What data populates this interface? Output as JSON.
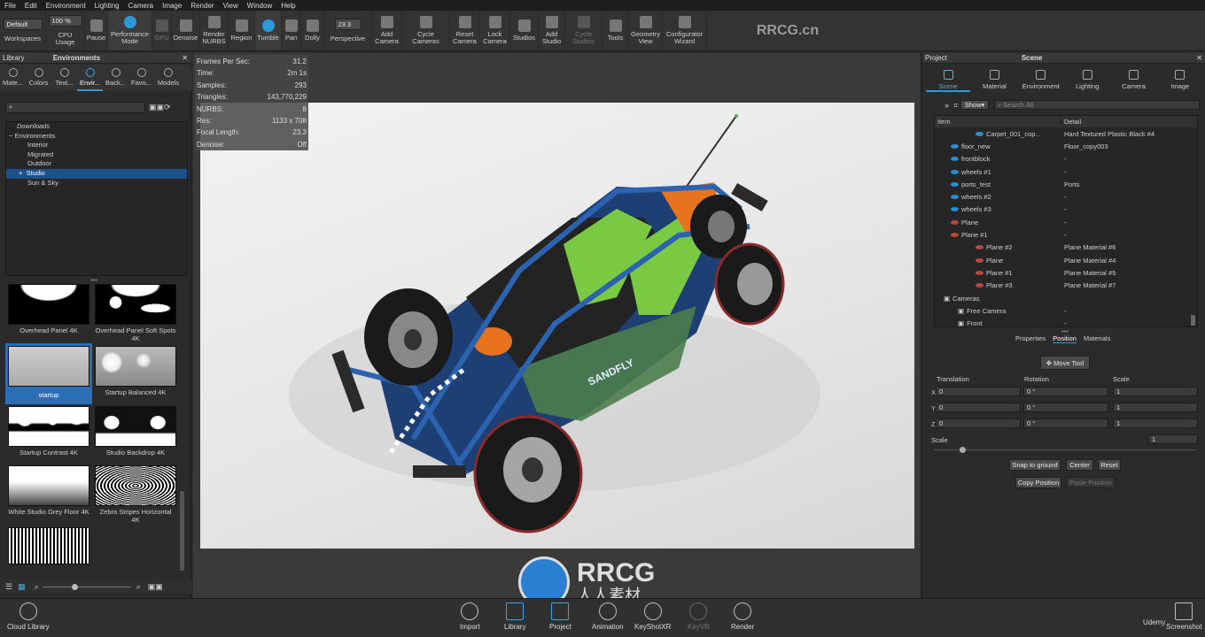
{
  "menu": [
    "File",
    "Edit",
    "Environment",
    "Lighting",
    "Camera",
    "Image",
    "Render",
    "View",
    "Window",
    "Help"
  ],
  "toolbar": {
    "workspace_select": "Default",
    "zoom_select": "100 %",
    "workspaces": "Workspaces",
    "cpu_usage": "CPU Usage",
    "pause": "Pause",
    "performance_mode": "Performance Mode",
    "gpu": "GPU",
    "denoise": "Denoise",
    "render_nurbs": "Render NURBS",
    "region": "Region",
    "tumble": "Tumble",
    "pan": "Pan",
    "dolly": "Dolly",
    "fov_value": "23.3",
    "perspective": "Perspective",
    "add_camera": "Add Camera",
    "cycle_cameras": "Cycle Cameras",
    "reset_camera": "Reset Camera",
    "lock_camera": "Lock Camera",
    "studios": "Studios",
    "add_studio": "Add Studio",
    "cycle_studios": "Cycle Studios",
    "tools": "Tools",
    "geometry_view": "Geometry View",
    "configurator_wizard": "Configurator Wizard"
  },
  "library": {
    "title": "Library",
    "panel_title": "Environments",
    "tabs": [
      "Mate...",
      "Colors",
      "Text...",
      "Envir...",
      "Back...",
      "Favo...",
      "Models"
    ],
    "active_tab": 3,
    "tree": [
      "Downloads",
      "Environments",
      "Interior",
      "Migrated",
      "Outdoor",
      "Studio",
      "Sun & Sky"
    ],
    "thumbnails": [
      {
        "label": "Overhead Panel 4K"
      },
      {
        "label": "Overhead Panel Soft Spots 4K"
      },
      {
        "label": "startup"
      },
      {
        "label": "Startup Balanced 4K"
      },
      {
        "label": "Startup Contrast 4K"
      },
      {
        "label": "Studio Backdrop 4K"
      },
      {
        "label": "White Studio Grey Floor 4K"
      },
      {
        "label": "Zebra Stripes Horizontal 4K"
      }
    ]
  },
  "stats": [
    {
      "k": "Frames Per Sec:",
      "v": "31.2"
    },
    {
      "k": "Time:",
      "v": "2m 1s"
    },
    {
      "k": "Samples:",
      "v": "293"
    },
    {
      "k": "Triangles:",
      "v": "143,770,229"
    },
    {
      "k": "NURBS:",
      "v": "8"
    },
    {
      "k": "Res:",
      "v": "1133 x 708"
    },
    {
      "k": "Focal Length:",
      "v": "23.3"
    },
    {
      "k": "Denoise:",
      "v": "Off"
    }
  ],
  "project": {
    "title": "Project",
    "panel_title": "Scene",
    "tabs": [
      "Scene",
      "Material",
      "Environment",
      "Lighting",
      "Camera",
      "Image"
    ],
    "show_button": "Show",
    "search_placeholder": "Search All",
    "columns": {
      "item": "Item",
      "detail": "Detail"
    },
    "rows": [
      {
        "item": "Carpet_001_cop...",
        "detail": "Hard Textured Plastic Black #4"
      },
      {
        "item": "floor_new",
        "detail": "Floor_copy003"
      },
      {
        "item": "frontblock",
        "detail": "-"
      },
      {
        "item": "wheels #1",
        "detail": "-"
      },
      {
        "item": "ports_test",
        "detail": "Ports"
      },
      {
        "item": "wheels #2",
        "detail": "-"
      },
      {
        "item": "wheels #3",
        "detail": "-"
      },
      {
        "item": "Plane",
        "detail": "-"
      },
      {
        "item": "Plane #1",
        "detail": "-"
      },
      {
        "item": "Plane #2",
        "detail": "Plane Material #6"
      },
      {
        "item": "Plane",
        "detail": "Plane Material #4"
      },
      {
        "item": "Plane #1",
        "detail": "Plane Material #5"
      },
      {
        "item": "Plane #3",
        "detail": "Plane Material #7"
      },
      {
        "item": "Cameras",
        "detail": ""
      },
      {
        "item": "Free Camera",
        "detail": "-"
      },
      {
        "item": "Front",
        "detail": "-"
      }
    ],
    "sub_tabs": [
      "Properties",
      "Position",
      "Materials"
    ],
    "move_tool": "Move Tool",
    "translation": "Translation",
    "rotation": "Rotation",
    "scale": "Scale",
    "axes": [
      "X",
      "Y",
      "Z"
    ],
    "translation_values": [
      "0",
      "0",
      "0"
    ],
    "rotation_values": [
      "0 °",
      "0 °",
      "0 °"
    ],
    "scale_values": [
      "1",
      "1",
      "1"
    ],
    "uniform_scale_label": "Scale",
    "uniform_scale_value": "1",
    "snap_to_ground": "Snap to ground",
    "center": "Center",
    "reset": "Reset",
    "copy_position": "Copy Position",
    "paste_position": "Paste Position"
  },
  "bottom": {
    "cloud_library": "Cloud Library",
    "import": "Import",
    "library": "Library",
    "project": "Project",
    "animation": "Animation",
    "keyshotxr": "KeyShotXR",
    "keyvr": "KeyVR",
    "render": "Render",
    "screenshot": "Screenshot"
  },
  "overlay": {
    "watermark_top": "RRCG.cn",
    "logo_text": "RRCG",
    "logo_sub": "人人素材",
    "car_decal": "SANDFLY",
    "udemy": "Udemy"
  },
  "colors": {
    "accent": "#2a9bd8",
    "selection": "#1e4f86",
    "car_blue": "#1f4f8f",
    "car_green": "#7ac943",
    "car_orange": "#e8731e"
  }
}
